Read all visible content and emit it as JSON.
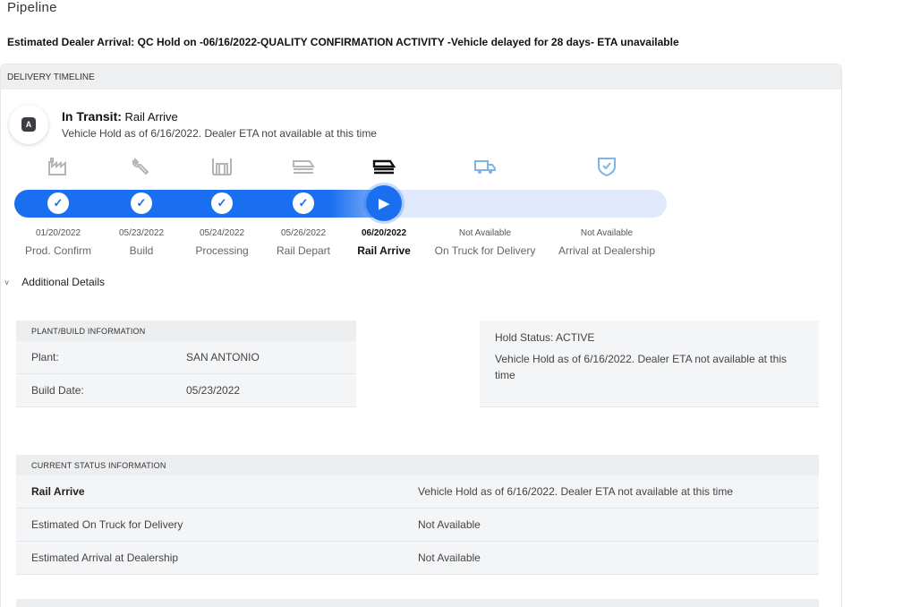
{
  "page": {
    "title": "Pipeline",
    "arrival_line": "Estimated Dealer Arrival: QC Hold on -06/16/2022-QUALITY CONFIRMATION ACTIVITY -Vehicle delayed for 28 days- ETA unavailable"
  },
  "timeline": {
    "header": "DELIVERY TIMELINE",
    "status_prefix": "In Transit:",
    "status_value": "Rail Arrive",
    "status_sub": "Vehicle Hold as of 6/16/2022. Dealer ETA not available at this time",
    "progress_fraction": 0.57,
    "stages": [
      {
        "date": "01/20/2022",
        "label": "Prod. Confirm",
        "icon": "factory-icon",
        "state": "done"
      },
      {
        "date": "05/23/2022",
        "label": "Build",
        "icon": "wrench-icon",
        "state": "done"
      },
      {
        "date": "05/24/2022",
        "label": "Processing",
        "icon": "processing-icon",
        "state": "done"
      },
      {
        "date": "05/26/2022",
        "label": "Rail Depart",
        "icon": "rail-depart-icon",
        "state": "done"
      },
      {
        "date": "06/20/2022",
        "label": "Rail Arrive",
        "icon": "rail-arrive-icon",
        "state": "current"
      },
      {
        "date": "Not Available",
        "label": "On Truck for Delivery",
        "icon": "truck-icon",
        "state": "pending"
      },
      {
        "date": "Not Available",
        "label": "Arrival at Dealership",
        "icon": "shield-check-icon",
        "state": "pending"
      }
    ]
  },
  "additional": {
    "label": "Additional Details"
  },
  "plant_info": {
    "header": "PLANT/BUILD INFORMATION",
    "rows": [
      {
        "key": "Plant:",
        "value": "SAN ANTONIO"
      },
      {
        "key": "Build Date:",
        "value": "05/23/2022"
      }
    ]
  },
  "hold": {
    "status": "Hold Status: ACTIVE",
    "message": "Vehicle Hold as of 6/16/2022. Dealer ETA not available at this time"
  },
  "current_status": {
    "header": "CURRENT STATUS INFORMATION",
    "rows": [
      {
        "key": "Rail Arrive",
        "value": "Vehicle Hold as of 6/16/2022. Dealer ETA not available at this time"
      },
      {
        "key": "Estimated On Truck for Delivery",
        "value": "Not Available"
      },
      {
        "key": "Estimated Arrival at Dealership",
        "value": "Not Available"
      }
    ]
  },
  "colors": {
    "accent": "#1a6ff0",
    "track": "#dfe9fb",
    "pending_icon": "#7fb4e8",
    "done_icon": "#b5b5b5"
  }
}
